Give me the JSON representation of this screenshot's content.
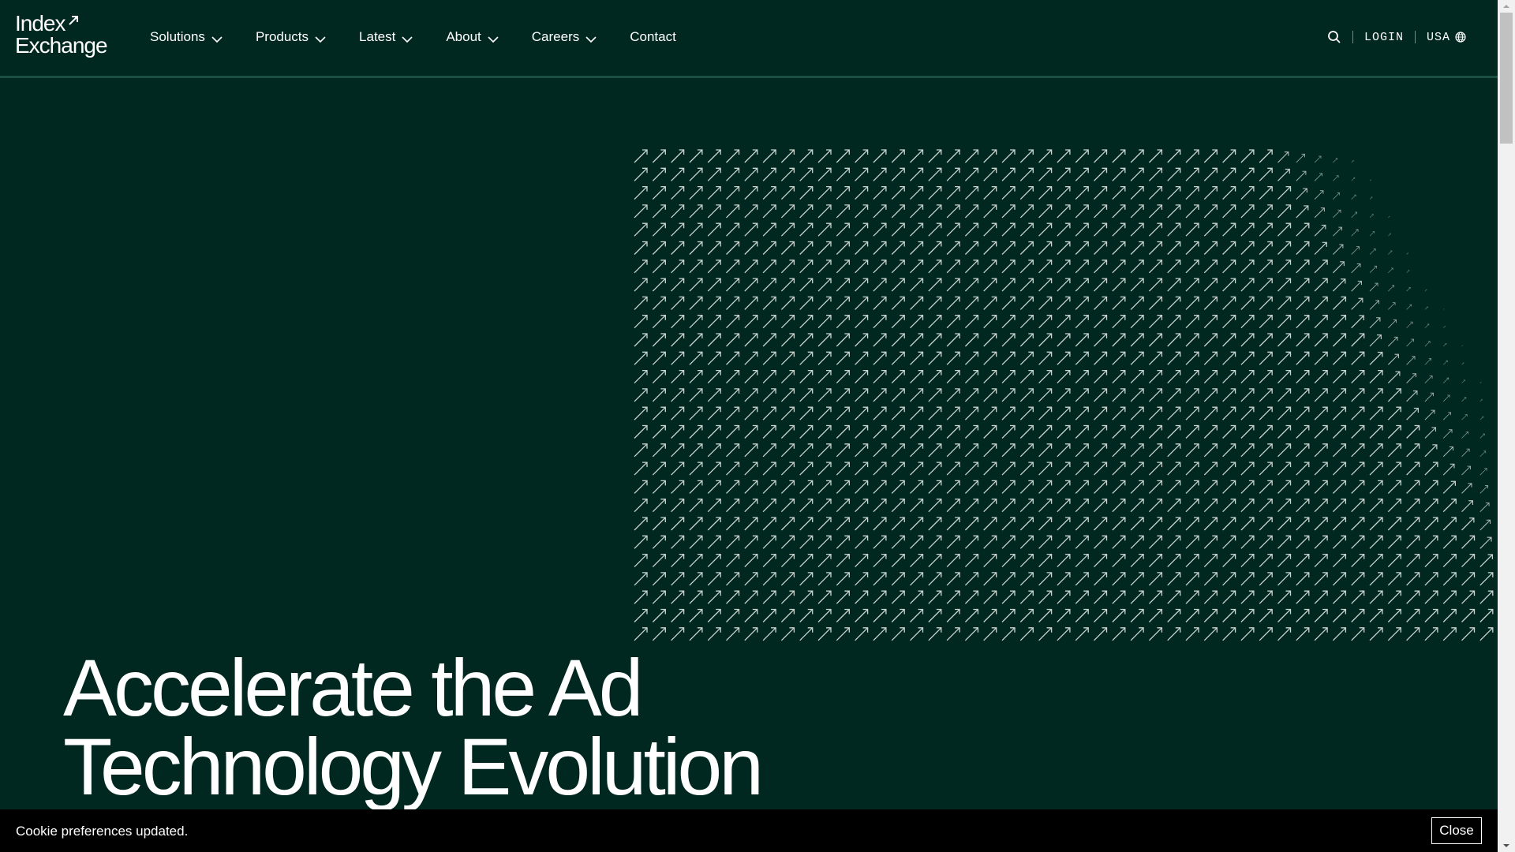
{
  "logo": {
    "line1": "Index",
    "line2": "Exchange"
  },
  "nav": {
    "items": [
      {
        "label": "Solutions",
        "has_dropdown": true
      },
      {
        "label": "Products",
        "has_dropdown": true
      },
      {
        "label": "Latest",
        "has_dropdown": true
      },
      {
        "label": "About",
        "has_dropdown": true
      },
      {
        "label": "Careers",
        "has_dropdown": true
      },
      {
        "label": "Contact",
        "has_dropdown": false
      }
    ]
  },
  "utility": {
    "search_icon": "search-icon",
    "login_label": "LOGIN",
    "region_label": "USA",
    "region_icon": "globe-icon"
  },
  "hero": {
    "title_line1": "Accelerate the Ad",
    "title_line2": "Technology Evolution"
  },
  "cookie_banner": {
    "message": "Cookie preferences updated.",
    "close_label": "Close"
  },
  "colors": {
    "background": "#012820",
    "header_border": "#1c4f43",
    "arrow_pattern": "#c9d4cf",
    "text": "#ffffff",
    "cookie_bar": "#000000"
  }
}
